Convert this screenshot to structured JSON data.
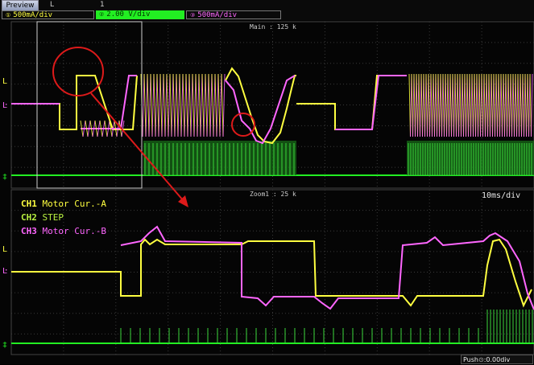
{
  "toolbar": {
    "preview_label": "Preview",
    "mini_readout_1": "L",
    "mini_readout_2": "1"
  },
  "channels": [
    {
      "id": "CH1",
      "scale": "500mA/div",
      "color": "#ffff40",
      "legend": "Motor Cur.-A"
    },
    {
      "id": "CH2",
      "scale": "2.00 V/div",
      "color": "#22ee22",
      "legend": "STEP"
    },
    {
      "id": "CH3",
      "scale": "500mA/div",
      "color": "#ff66ff",
      "legend": "Motor Cur.-B"
    }
  ],
  "main_window": {
    "label": "Main : 125 k"
  },
  "zoom_window": {
    "label": "Zoom1 : 25 k",
    "timebase": "10ms/div"
  },
  "status": {
    "push_label": "Push",
    "push_value": ":0.00div"
  },
  "colors": {
    "grid": "#3a3a3a",
    "annotation": "#dd1a1a",
    "zoom_box": "#cfcfcf"
  }
}
